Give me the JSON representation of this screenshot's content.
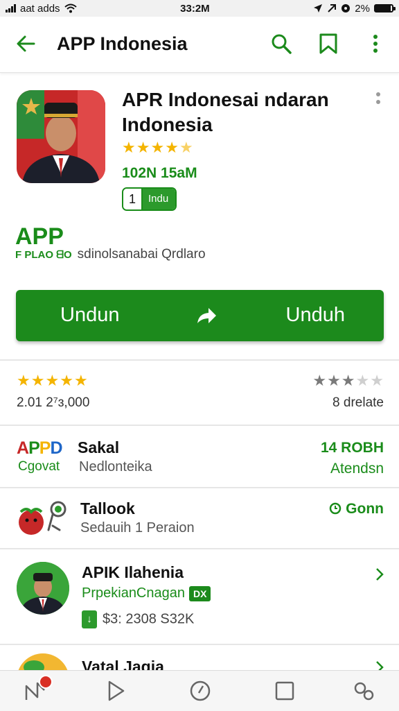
{
  "status": {
    "left": "aat adds",
    "time": "33:2M",
    "battery_text": "2%",
    "battery_level": 0.9
  },
  "appbar": {
    "title": "APP Indonesia",
    "icons": [
      "back-arrow-icon",
      "search-icon",
      "bookmark-icon",
      "more-vert-icon"
    ]
  },
  "app": {
    "title": "APR Indonesai ndaran Indonesia",
    "rating": 4.5,
    "downloads": "102N 15aM",
    "badge_num": "1",
    "badge_tag": "Indu"
  },
  "subtitle": {
    "big": "APP",
    "small_green": "F PLAO ᗺO",
    "small_text": "sdinolsanabai Qrdlaro"
  },
  "install": {
    "left_label": "Undun",
    "right_label": "Unduh"
  },
  "ratings": {
    "left": {
      "stars": 5,
      "count": "2.01 2⁷ɜ,000"
    },
    "right": {
      "stars": 3,
      "count": "8 drelate"
    }
  },
  "rows": [
    {
      "logo": "APPD",
      "logo_sub": "Cgovat",
      "title": "Sakal",
      "subtitle": "Nedlonteika",
      "right_top": "14 ROBH",
      "right_bottom": "Atendsn"
    },
    {
      "title": "Tallook",
      "subtitle": "Sedauih 1 Peraion",
      "right_top": "Gonn"
    },
    {
      "title": "APIK Ilahenia",
      "subtitle": "PrpekianCnagan",
      "chip": "DX",
      "price": "$3: 2308 S32K"
    },
    {
      "title": "Vatal Jagia"
    }
  ],
  "colors": {
    "accent": "#1c8a1c",
    "star": "#f4b400",
    "star_empty": "#cfcfcf"
  }
}
